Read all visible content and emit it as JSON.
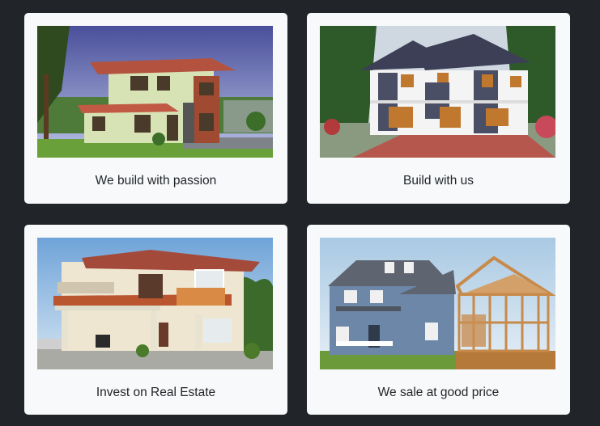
{
  "cards": [
    {
      "caption": "We build with passion",
      "image": "two-story-green-house-photo"
    },
    {
      "caption": "Build with us",
      "image": "modern-white-villa-photo"
    },
    {
      "caption": "Invest on Real Estate",
      "image": "cream-two-story-house-photo"
    },
    {
      "caption": "We sale at good price",
      "image": "finished-vs-framing-house-photo"
    }
  ],
  "colors": {
    "page_background": "#212529",
    "card_background": "#f8f9fa",
    "caption_text": "#212529"
  }
}
